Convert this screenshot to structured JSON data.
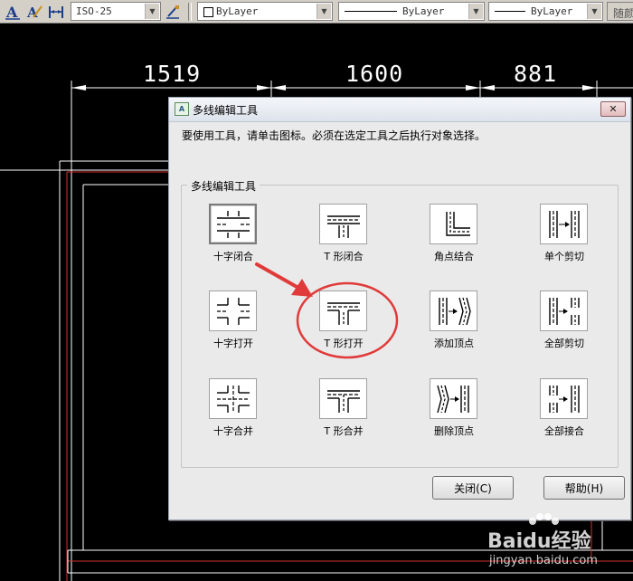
{
  "toolbar": {
    "dimstyle_value": "ISO-25",
    "layer_color": "ByLayer",
    "linetype": "ByLayer",
    "lineweight": "ByLayer",
    "plotstyle": "随颜"
  },
  "canvas": {
    "dimensions": [
      "1519",
      "1600",
      "881"
    ]
  },
  "dialog": {
    "title": "多线编辑工具",
    "icon_text": "A",
    "close_glyph": "✕",
    "instruction": "要使用工具，请单击图标。必须在选定工具之后执行对象选择。",
    "group_label": "多线编辑工具",
    "tools": [
      {
        "label": "十字闭合",
        "icon": "cross-closed-icon"
      },
      {
        "label": "T 形闭合",
        "icon": "tee-closed-icon"
      },
      {
        "label": "角点结合",
        "icon": "corner-joint-icon"
      },
      {
        "label": "单个剪切",
        "icon": "cut-single-icon"
      },
      {
        "label": "十字打开",
        "icon": "cross-open-icon"
      },
      {
        "label": "T 形打开",
        "icon": "tee-open-icon"
      },
      {
        "label": "添加顶点",
        "icon": "add-vertex-icon"
      },
      {
        "label": "全部剪切",
        "icon": "cut-all-icon"
      },
      {
        "label": "十字合并",
        "icon": "cross-merged-icon"
      },
      {
        "label": "T 形合并",
        "icon": "tee-merged-icon"
      },
      {
        "label": "删除顶点",
        "icon": "delete-vertex-icon"
      },
      {
        "label": "全部接合",
        "icon": "weld-all-icon"
      }
    ],
    "close_button": "关闭(C)",
    "help_button": "帮助(H)"
  },
  "watermark": {
    "brand": "Baidu经验",
    "url": "jingyan.baidu.com"
  },
  "colors": {
    "annotation_red": "#e03a3a",
    "dialog_bg": "#eaeaea"
  }
}
